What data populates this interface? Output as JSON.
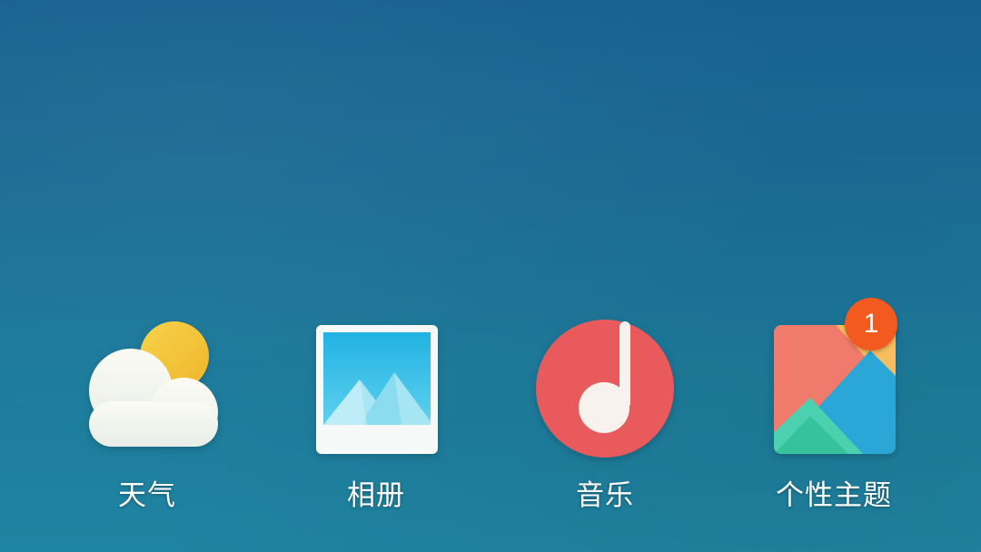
{
  "home_screen": {
    "apps": [
      {
        "label": "天气",
        "icon": "weather-icon"
      },
      {
        "label": "相册",
        "icon": "gallery-icon"
      },
      {
        "label": "音乐",
        "icon": "music-icon"
      },
      {
        "label": "个性主题",
        "icon": "themes-icon",
        "badge": "1"
      }
    ]
  },
  "colors": {
    "wallpaper_top": "#17608f",
    "wallpaper_bottom": "#1f84a1",
    "badge": "#f25a1f",
    "music_red": "#e85a5c",
    "sun_yellow": "#f3c33b"
  }
}
